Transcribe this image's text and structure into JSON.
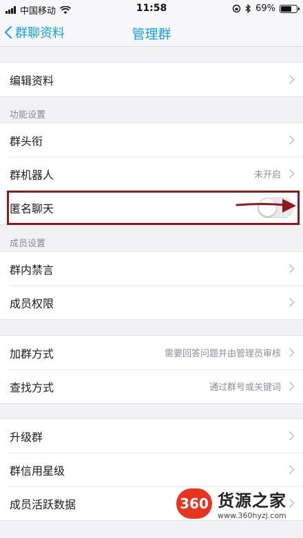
{
  "status_bar": {
    "carrier": "中国移动",
    "time": "11:58",
    "battery": "69%",
    "battery_level": 0.69
  },
  "nav": {
    "back_label": "群聊资料",
    "title": "管理群"
  },
  "groups": [
    {
      "items": [
        {
          "label": "编辑资料"
        }
      ]
    },
    {
      "header": "功能设置",
      "items": [
        {
          "label": "群头衔"
        },
        {
          "label": "群机器人",
          "value": "未开启"
        },
        {
          "label": "匿名聊天",
          "toggle": false
        }
      ]
    },
    {
      "header": "成员设置",
      "items": [
        {
          "label": "群内禁言"
        },
        {
          "label": "成员权限"
        }
      ]
    },
    {
      "items": [
        {
          "label": "加群方式",
          "value": "需要回答问题并由管理员审核"
        },
        {
          "label": "查找方式",
          "value": "通过群号或关键词"
        }
      ]
    },
    {
      "items": [
        {
          "label": "升级群"
        },
        {
          "label": "群信用星级"
        },
        {
          "label": "成员活跃数据"
        }
      ]
    }
  ],
  "watermark": {
    "badge": "360",
    "name": "货源之家",
    "url": "www.360hyzj.com"
  },
  "colors": {
    "accent": "#12a2f0",
    "highlight": "#8c1a1a"
  }
}
